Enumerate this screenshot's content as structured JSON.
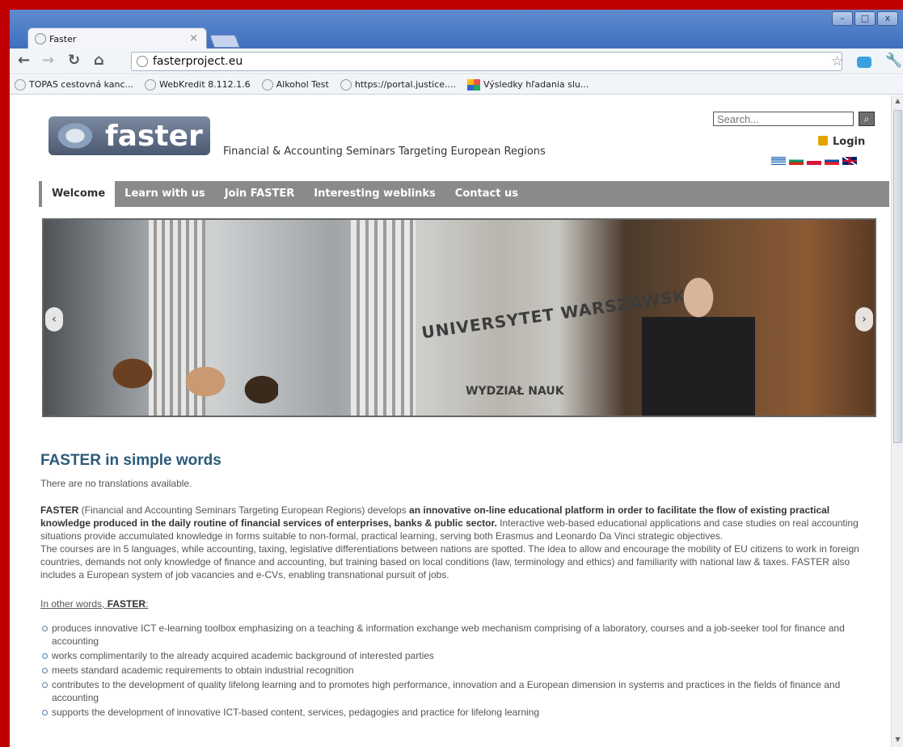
{
  "browser": {
    "tab_title": "Faster",
    "url": "fasterproject.eu",
    "window_controls": [
      "–",
      "□",
      "x"
    ],
    "nav_icons": [
      "back-arrow-icon",
      "forward-arrow-icon",
      "reload-icon",
      "home-icon"
    ],
    "bookmarks": [
      {
        "label": "TOPAS cestovná kanc...",
        "icon": "globe-icon"
      },
      {
        "label": "WebKredit 8.112.1.6",
        "icon": "globe-icon"
      },
      {
        "label": "Alkohol Test",
        "icon": "globe-icon"
      },
      {
        "label": "https://portal.justice....",
        "icon": "globe-icon"
      },
      {
        "label": "Výsledky hľadania slu...",
        "icon": "colorful-icon"
      }
    ]
  },
  "site": {
    "logo_text": "faster",
    "tagline": "Financial & Accounting Seminars Targeting European Regions",
    "search_placeholder": "Search...",
    "login_label": "Login",
    "flags": [
      {
        "name": "greek-flag",
        "colors": [
          "#0d5eaf",
          "#ffffff"
        ]
      },
      {
        "name": "bulgarian-flag",
        "colors": [
          "#ffffff",
          "#00966e",
          "#d62612"
        ]
      },
      {
        "name": "polish-flag",
        "colors": [
          "#ffffff",
          "#dc143c"
        ]
      },
      {
        "name": "slovak-flag",
        "colors": [
          "#ffffff",
          "#0b4ea2",
          "#ee1c25"
        ]
      },
      {
        "name": "uk-flag",
        "colors": [
          "#012169",
          "#ffffff",
          "#c8102e"
        ]
      }
    ]
  },
  "menu": [
    "Welcome",
    "Learn with us",
    "Join FASTER",
    "Interesting weblinks",
    "Contact us"
  ],
  "slider": {
    "sign_main": "UNIVERSYTET WARSZAWSKI",
    "sign_small": "WYDZIAŁ NAUK"
  },
  "article": {
    "title": "FASTER in simple words",
    "no_translations": "There are no translations available.",
    "para1": "FASTER (Financial and Accounting Seminars Targeting European Regions) develops an innovative on-line educational platform in order to facilitate the flow of existing practical knowledge produced in the daily routine of financial services of enterprises, banks & public sector. Interactive web-based educational applications and case studies on real accounting situations provide accumulated knowledge in forms suitable to non-formal, practical learning, serving  both Erasmus and Leonardo Da Vinci strategic objectives.",
    "para2": "The  courses are in 5 languages, while accounting, taxing, legislative differentiations between nations are spotted. The idea to allow and encourage the mobility of EU citizens to work in foreign countries, demands not only knowledge of finance and accounting, but training based on local conditions (law, terminology and ethics) and familiarity with national law & taxes. FASTER also includes a European system of job vacancies and  e-CVs, enabling transnational pursuit of jobs.",
    "other_words_prefix": "In other words, ",
    "other_words_bold": "FASTER",
    "other_words_suffix": ":",
    "list": [
      "produces innovative ICT e-learning toolbox emphasizing on a teaching & information exchange web mechanism comprising of a laboratory, courses and a job-seeker tool for finance and accounting",
      "works complimentarily to the already acquired academic background of interested parties",
      "meets standard academic requirements to obtain industrial recognition",
      "contributes to the development of quality lifelong learning and to promotes high performance, innovation and a European dimension in systems and practices in the fields of finance and accounting",
      "supports the development of innovative ICT-based content, services, pedagogies and practice for lifelong learning"
    ]
  }
}
